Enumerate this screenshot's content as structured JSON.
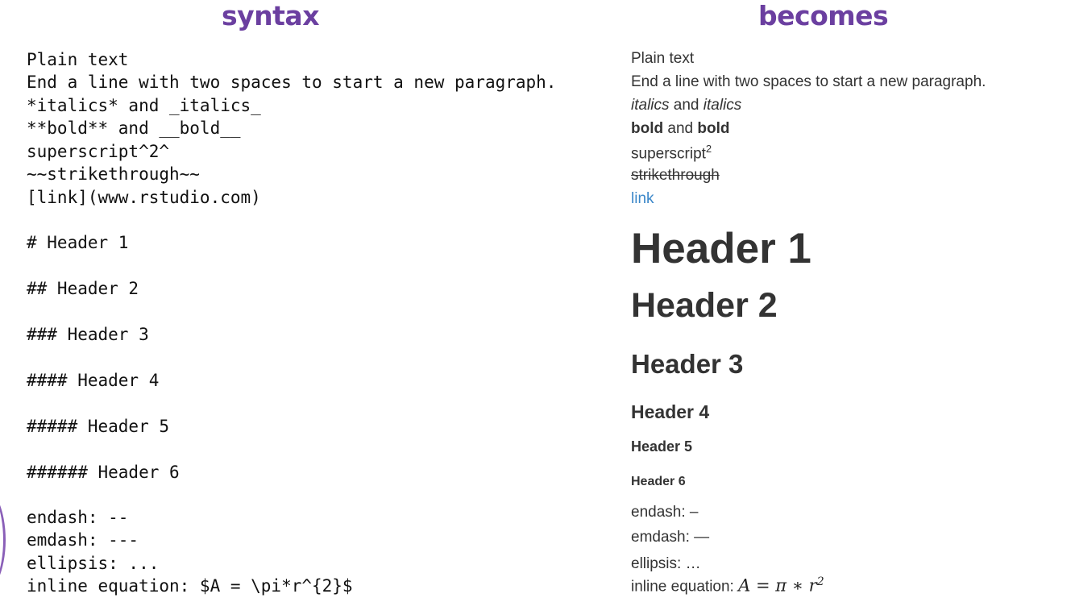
{
  "titles": {
    "left": "syntax",
    "right": "becomes"
  },
  "syntax": {
    "plain": "Plain text",
    "paragraph": "End a line with two spaces to start a new paragraph.",
    "italics": "*italics* and _italics_",
    "bold": "**bold** and __bold__",
    "superscript": "superscript^2^",
    "strikethrough": "~~strikethrough~~",
    "link": "[link](www.rstudio.com)",
    "h1": "# Header 1",
    "h2": "## Header 2",
    "h3": "### Header 3",
    "h4": "#### Header 4",
    "h5": "##### Header 5",
    "h6": "###### Header 6",
    "endash": "endash: --",
    "emdash": "emdash: ---",
    "ellipsis": "ellipsis: ...",
    "equation": "inline equation: $A = \\pi*r^{2}$"
  },
  "output": {
    "plain": "Plain text",
    "paragraph": "End a line with two spaces to start a new paragraph.",
    "italics_a": "italics",
    "and_1": " and ",
    "italics_b": "italics",
    "bold_a": "bold",
    "and_2": " and ",
    "bold_b": "bold",
    "superscript_base": "superscript",
    "superscript_exp": "2",
    "strikethrough": "strikethrough",
    "link": "link",
    "h1": "Header 1",
    "h2": "Header 2",
    "h3": "Header 3",
    "h4": "Header 4",
    "h5": "Header 5",
    "h6": "Header 6",
    "endash": "endash: –",
    "emdash": "emdash: —",
    "ellipsis": "ellipsis: …",
    "equation_label": "inline equation: ",
    "equation_math": "A = π ∗ r",
    "equation_exp": "2"
  },
  "colors": {
    "title": "#6b3fa0",
    "link": "#3b87c9",
    "text": "#333333"
  }
}
